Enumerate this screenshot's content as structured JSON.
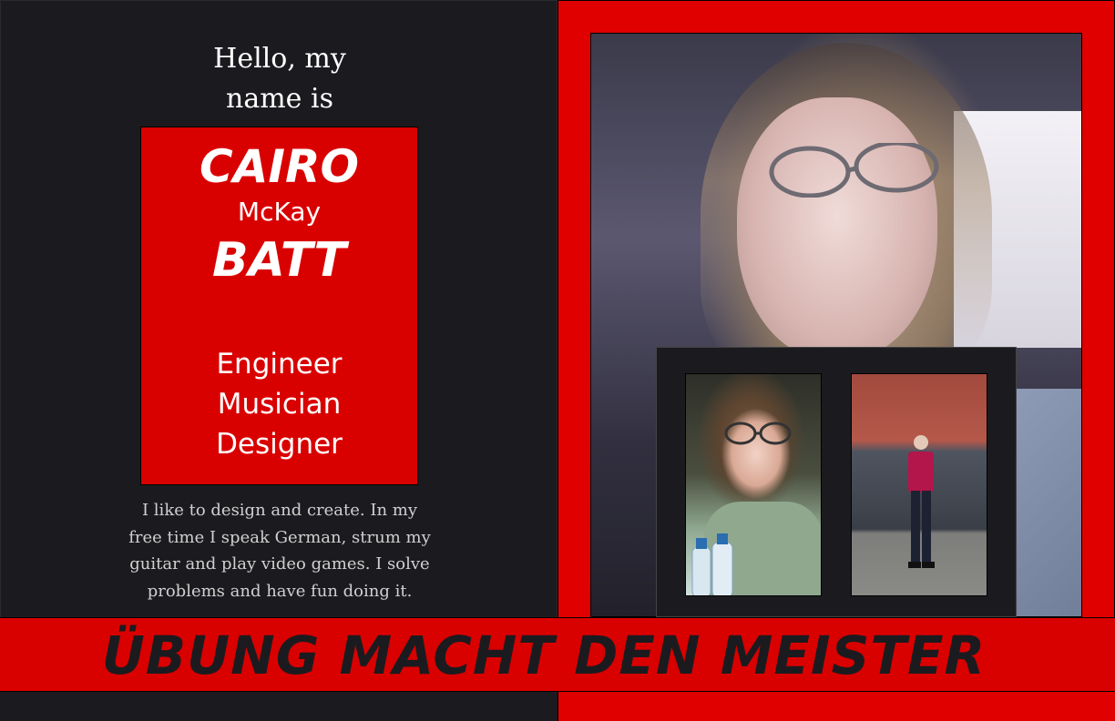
{
  "greeting": {
    "line1": "Hello, my",
    "line2": "name is"
  },
  "name_card": {
    "first_name": "CAIRO",
    "middle_name": "McKay",
    "last_name": "BATT",
    "roles": [
      "Engineer",
      "Musician",
      "Designer"
    ]
  },
  "bio": {
    "lines": [
      "I like to design and create. In my",
      "free time I speak German, strum my",
      "guitar and play video games. I solve",
      "problems and have fun doing it."
    ]
  },
  "banner": {
    "text": "ÜBUNG MACHT DEN MEISTER"
  },
  "colors": {
    "accent_red": "#d90000",
    "dark_background": "#1b1b1f",
    "text_white": "#ffffff",
    "bio_gray": "#d0d0d0"
  }
}
